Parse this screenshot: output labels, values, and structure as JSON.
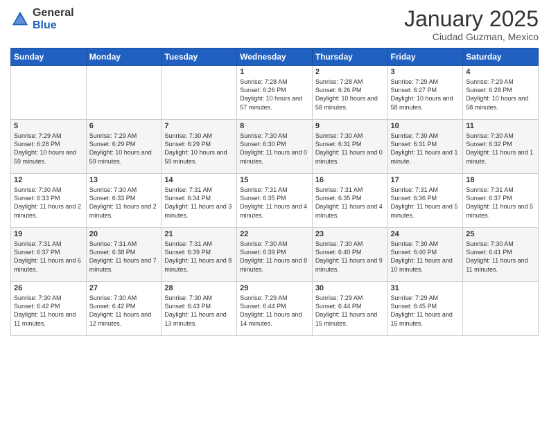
{
  "header": {
    "logo_general": "General",
    "logo_blue": "Blue",
    "month_title": "January 2025",
    "subtitle": "Ciudad Guzman, Mexico"
  },
  "days_of_week": [
    "Sunday",
    "Monday",
    "Tuesday",
    "Wednesday",
    "Thursday",
    "Friday",
    "Saturday"
  ],
  "weeks": [
    [
      {
        "day": "",
        "sunrise": "",
        "sunset": "",
        "daylight": ""
      },
      {
        "day": "",
        "sunrise": "",
        "sunset": "",
        "daylight": ""
      },
      {
        "day": "",
        "sunrise": "",
        "sunset": "",
        "daylight": ""
      },
      {
        "day": "1",
        "sunrise": "Sunrise: 7:28 AM",
        "sunset": "Sunset: 6:26 PM",
        "daylight": "Daylight: 10 hours and 57 minutes."
      },
      {
        "day": "2",
        "sunrise": "Sunrise: 7:28 AM",
        "sunset": "Sunset: 6:26 PM",
        "daylight": "Daylight: 10 hours and 58 minutes."
      },
      {
        "day": "3",
        "sunrise": "Sunrise: 7:29 AM",
        "sunset": "Sunset: 6:27 PM",
        "daylight": "Daylight: 10 hours and 58 minutes."
      },
      {
        "day": "4",
        "sunrise": "Sunrise: 7:29 AM",
        "sunset": "Sunset: 6:28 PM",
        "daylight": "Daylight: 10 hours and 58 minutes."
      }
    ],
    [
      {
        "day": "5",
        "sunrise": "Sunrise: 7:29 AM",
        "sunset": "Sunset: 6:28 PM",
        "daylight": "Daylight: 10 hours and 59 minutes."
      },
      {
        "day": "6",
        "sunrise": "Sunrise: 7:29 AM",
        "sunset": "Sunset: 6:29 PM",
        "daylight": "Daylight: 10 hours and 59 minutes."
      },
      {
        "day": "7",
        "sunrise": "Sunrise: 7:30 AM",
        "sunset": "Sunset: 6:29 PM",
        "daylight": "Daylight: 10 hours and 59 minutes."
      },
      {
        "day": "8",
        "sunrise": "Sunrise: 7:30 AM",
        "sunset": "Sunset: 6:30 PM",
        "daylight": "Daylight: 11 hours and 0 minutes."
      },
      {
        "day": "9",
        "sunrise": "Sunrise: 7:30 AM",
        "sunset": "Sunset: 6:31 PM",
        "daylight": "Daylight: 11 hours and 0 minutes."
      },
      {
        "day": "10",
        "sunrise": "Sunrise: 7:30 AM",
        "sunset": "Sunset: 6:31 PM",
        "daylight": "Daylight: 11 hours and 1 minute."
      },
      {
        "day": "11",
        "sunrise": "Sunrise: 7:30 AM",
        "sunset": "Sunset: 6:32 PM",
        "daylight": "Daylight: 11 hours and 1 minute."
      }
    ],
    [
      {
        "day": "12",
        "sunrise": "Sunrise: 7:30 AM",
        "sunset": "Sunset: 6:33 PM",
        "daylight": "Daylight: 11 hours and 2 minutes."
      },
      {
        "day": "13",
        "sunrise": "Sunrise: 7:30 AM",
        "sunset": "Sunset: 6:33 PM",
        "daylight": "Daylight: 11 hours and 2 minutes."
      },
      {
        "day": "14",
        "sunrise": "Sunrise: 7:31 AM",
        "sunset": "Sunset: 6:34 PM",
        "daylight": "Daylight: 11 hours and 3 minutes."
      },
      {
        "day": "15",
        "sunrise": "Sunrise: 7:31 AM",
        "sunset": "Sunset: 6:35 PM",
        "daylight": "Daylight: 11 hours and 4 minutes."
      },
      {
        "day": "16",
        "sunrise": "Sunrise: 7:31 AM",
        "sunset": "Sunset: 6:35 PM",
        "daylight": "Daylight: 11 hours and 4 minutes."
      },
      {
        "day": "17",
        "sunrise": "Sunrise: 7:31 AM",
        "sunset": "Sunset: 6:36 PM",
        "daylight": "Daylight: 11 hours and 5 minutes."
      },
      {
        "day": "18",
        "sunrise": "Sunrise: 7:31 AM",
        "sunset": "Sunset: 6:37 PM",
        "daylight": "Daylight: 11 hours and 5 minutes."
      }
    ],
    [
      {
        "day": "19",
        "sunrise": "Sunrise: 7:31 AM",
        "sunset": "Sunset: 6:37 PM",
        "daylight": "Daylight: 11 hours and 6 minutes."
      },
      {
        "day": "20",
        "sunrise": "Sunrise: 7:31 AM",
        "sunset": "Sunset: 6:38 PM",
        "daylight": "Daylight: 11 hours and 7 minutes."
      },
      {
        "day": "21",
        "sunrise": "Sunrise: 7:31 AM",
        "sunset": "Sunset: 6:39 PM",
        "daylight": "Daylight: 11 hours and 8 minutes."
      },
      {
        "day": "22",
        "sunrise": "Sunrise: 7:30 AM",
        "sunset": "Sunset: 6:39 PM",
        "daylight": "Daylight: 11 hours and 8 minutes."
      },
      {
        "day": "23",
        "sunrise": "Sunrise: 7:30 AM",
        "sunset": "Sunset: 6:40 PM",
        "daylight": "Daylight: 11 hours and 9 minutes."
      },
      {
        "day": "24",
        "sunrise": "Sunrise: 7:30 AM",
        "sunset": "Sunset: 6:40 PM",
        "daylight": "Daylight: 11 hours and 10 minutes."
      },
      {
        "day": "25",
        "sunrise": "Sunrise: 7:30 AM",
        "sunset": "Sunset: 6:41 PM",
        "daylight": "Daylight: 11 hours and 11 minutes."
      }
    ],
    [
      {
        "day": "26",
        "sunrise": "Sunrise: 7:30 AM",
        "sunset": "Sunset: 6:42 PM",
        "daylight": "Daylight: 11 hours and 11 minutes."
      },
      {
        "day": "27",
        "sunrise": "Sunrise: 7:30 AM",
        "sunset": "Sunset: 6:42 PM",
        "daylight": "Daylight: 11 hours and 12 minutes."
      },
      {
        "day": "28",
        "sunrise": "Sunrise: 7:30 AM",
        "sunset": "Sunset: 6:43 PM",
        "daylight": "Daylight: 11 hours and 13 minutes."
      },
      {
        "day": "29",
        "sunrise": "Sunrise: 7:29 AM",
        "sunset": "Sunset: 6:44 PM",
        "daylight": "Daylight: 11 hours and 14 minutes."
      },
      {
        "day": "30",
        "sunrise": "Sunrise: 7:29 AM",
        "sunset": "Sunset: 6:44 PM",
        "daylight": "Daylight: 11 hours and 15 minutes."
      },
      {
        "day": "31",
        "sunrise": "Sunrise: 7:29 AM",
        "sunset": "Sunset: 6:45 PM",
        "daylight": "Daylight: 11 hours and 15 minutes."
      },
      {
        "day": "",
        "sunrise": "",
        "sunset": "",
        "daylight": ""
      }
    ]
  ]
}
